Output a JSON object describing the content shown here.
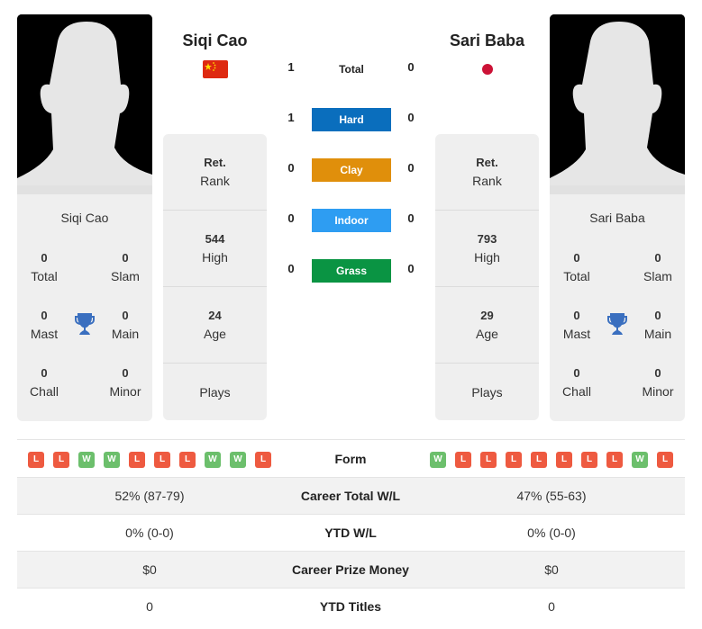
{
  "player1": {
    "name": "Siqi Cao",
    "flag": "china-flag-icon",
    "card_name": "Siqi Cao",
    "titles": {
      "total": "0",
      "slam": "0",
      "mast": "0",
      "main": "0",
      "chall": "0",
      "minor": "0"
    },
    "stats": {
      "rank_value": "Ret.",
      "rank_label": "Rank",
      "high_value": "544",
      "high_label": "High",
      "age_value": "24",
      "age_label": "Age",
      "plays_label": "Plays"
    },
    "form": [
      "L",
      "L",
      "W",
      "W",
      "L",
      "L",
      "L",
      "W",
      "W",
      "L"
    ],
    "career_total_wl": "52% (87-79)",
    "ytd_wl": "0% (0-0)",
    "career_prize_money": "$0",
    "ytd_titles": "0"
  },
  "player2": {
    "name": "Sari Baba",
    "flag": "japan-flag-icon",
    "card_name": "Sari Baba",
    "titles": {
      "total": "0",
      "slam": "0",
      "mast": "0",
      "main": "0",
      "chall": "0",
      "minor": "0"
    },
    "stats": {
      "rank_value": "Ret.",
      "rank_label": "Rank",
      "high_value": "793",
      "high_label": "High",
      "age_value": "29",
      "age_label": "Age",
      "plays_label": "Plays"
    },
    "form": [
      "W",
      "L",
      "L",
      "L",
      "L",
      "L",
      "L",
      "L",
      "W",
      "L"
    ],
    "career_total_wl": "47% (55-63)",
    "ytd_wl": "0% (0-0)",
    "career_prize_money": "$0",
    "ytd_titles": "0"
  },
  "title_labels": {
    "total": "Total",
    "slam": "Slam",
    "mast": "Mast",
    "main": "Main",
    "chall": "Chall",
    "minor": "Minor"
  },
  "h2h": {
    "total": {
      "label": "Total",
      "p1": "1",
      "p2": "0"
    },
    "surfaces": [
      {
        "label": "Hard",
        "p1": "1",
        "p2": "0",
        "color": "#0a6ebd"
      },
      {
        "label": "Clay",
        "p1": "0",
        "p2": "0",
        "color": "#e08f0b"
      },
      {
        "label": "Indoor",
        "p1": "0",
        "p2": "0",
        "color": "#2e9df2"
      },
      {
        "label": "Grass",
        "p1": "0",
        "p2": "0",
        "color": "#0a9443"
      }
    ]
  },
  "comparison": {
    "form_label": "Form",
    "rows": [
      {
        "label": "Career Total W/L"
      },
      {
        "label": "YTD W/L"
      },
      {
        "label": "Career Prize Money"
      },
      {
        "label": "YTD Titles"
      }
    ]
  },
  "colors": {
    "win": "#6cbf6c",
    "loss": "#ee5a40",
    "trophy": "#3a6fbf",
    "card_bg": "#efefef"
  }
}
